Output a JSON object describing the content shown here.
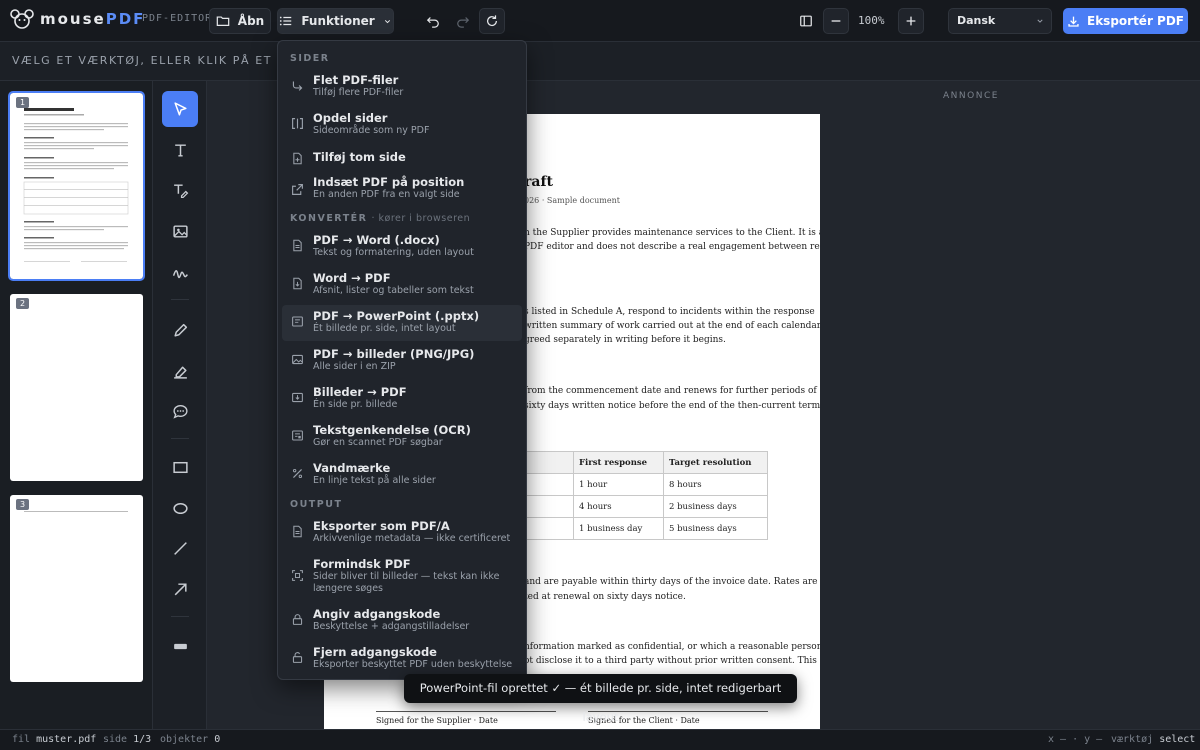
{
  "app": {
    "brand_main": "mouse",
    "brand_accent": "PDF",
    "tag": "PDF-EDITOR"
  },
  "toolbar": {
    "open_label": "Åbn",
    "functions_label": "Funktioner",
    "zoom": "100%",
    "language": "Dansk",
    "export_label": "Eksportér PDF"
  },
  "hint": "Vælg et værktøj, eller klik på et objekt — ko",
  "ad_label": "ANNONCE",
  "thumbnails": [
    {
      "num": "1"
    },
    {
      "num": "2"
    },
    {
      "num": "3"
    }
  ],
  "menu": {
    "sections": [
      {
        "title": "Sider",
        "subtitle": ""
      },
      {
        "title": "Konvertér",
        "subtitle": "· kører i browseren"
      },
      {
        "title": "Output",
        "subtitle": ""
      }
    ],
    "items": [
      {
        "label": "Flet PDF-filer",
        "sub": "Tilføj flere PDF-filer",
        "icon": "merge-icon"
      },
      {
        "label": "Opdel sider",
        "sub": "Sideområde som ny PDF",
        "icon": "split-icon"
      },
      {
        "label": "Tilføj tom side",
        "sub": "",
        "icon": "add-page-icon"
      },
      {
        "label": "Indsæt PDF på position",
        "sub": "En anden PDF fra en valgt side",
        "icon": "insert-icon"
      },
      {
        "label": "PDF → Word (.docx)",
        "sub": "Tekst og formatering, uden layout",
        "icon": "word-icon"
      },
      {
        "label": "Word → PDF",
        "sub": "Afsnit, lister og tabeller som tekst",
        "icon": "word-to-pdf-icon"
      },
      {
        "label": "PDF → PowerPoint (.pptx)",
        "sub": "Ét billede pr. side, intet layout",
        "icon": "powerpoint-icon"
      },
      {
        "label": "PDF → billeder (PNG/JPG)",
        "sub": "Alle sider i en ZIP",
        "icon": "image-icon"
      },
      {
        "label": "Billeder → PDF",
        "sub": "Én side pr. billede",
        "icon": "images-to-pdf-icon"
      },
      {
        "label": "Tekstgenkendelse (OCR)",
        "sub": "Gør en scannet PDF søgbar",
        "icon": "ocr-icon"
      },
      {
        "label": "Vandmærke",
        "sub": "En linje tekst på alle sider",
        "icon": "watermark-icon"
      },
      {
        "label": "Eksporter som PDF/A",
        "sub": "Arkivvenlige metadata — ikke certificeret",
        "icon": "archive-icon"
      },
      {
        "label": "Formindsk PDF",
        "sub": "Sider bliver til billeder — tekst kan ikke længere søges",
        "icon": "compress-icon"
      },
      {
        "label": "Angiv adgangskode",
        "sub": "Beskyttelse + adgangstilladelser",
        "icon": "lock-icon"
      },
      {
        "label": "Fjern adgangskode",
        "sub": "Eksporter beskyttet PDF uden beskyttelse",
        "icon": "unlock-icon"
      }
    ]
  },
  "document": {
    "title_fragment": "raft",
    "date_fragment": "026 · Sample document",
    "p1": [
      "n the Supplier provides maintenance services to the Client. It is a",
      "PDF editor and does not describe a real engagement between real"
    ],
    "p2": [
      "s listed in Schedule A, respond to incidents within the response",
      "written summary of work carried out at the end of each calendar",
      "greed separately in writing before it begins."
    ],
    "p3": [
      "from the commencement date and renews for further periods of",
      "sixty days written notice before the end of the then-current term."
    ],
    "table_headers": [
      "First response",
      "Target resolution"
    ],
    "table_rows": [
      [
        "1 hour",
        "8 hours"
      ],
      [
        "4 hours",
        "2 business days"
      ],
      [
        "1 business day",
        "5 business days"
      ]
    ],
    "p4": [
      "and are payable within thirty days of the invoice date. Rates are",
      "ted at renewal on sixty days notice."
    ],
    "p5": [
      "nformation marked as confidential, or which a reasonable person",
      "ot disclose it to a third party without prior written consent. This"
    ],
    "sign_supplier": "Signed for the Supplier · Date",
    "sign_client": "Signed for the Client · Date"
  },
  "toast": "PowerPoint-fil oprettet ✓ — ét billede pr. side, intet redigerbart layout",
  "status": {
    "file_label": "fil",
    "file": "muster.pdf",
    "page_label": "side",
    "page": "1/3",
    "objects_label": "objekter",
    "objects": "0",
    "coords": "x — · y —",
    "tool_label": "værktøj",
    "tool": "select"
  }
}
